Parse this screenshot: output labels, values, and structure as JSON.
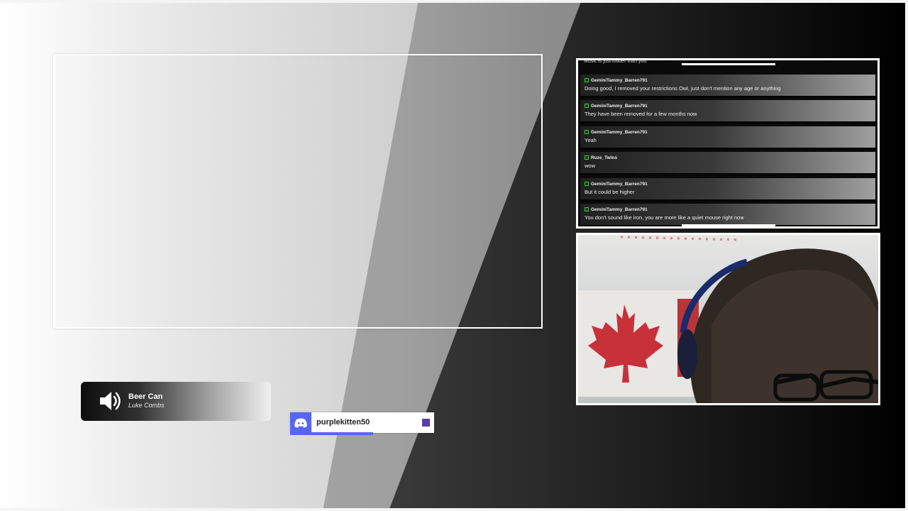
{
  "colors": {
    "frame_border": "#ffffff",
    "discord_blurple": "#5865f2",
    "discord_square": "#5a3ea8",
    "chat_badge": "#3fbf3f"
  },
  "chat": {
    "cutoff_text": "Music is just louder than you",
    "messages": [
      {
        "user": "GeminiTammy_Barren791",
        "text": "Doing good, I removed your restrictions Owl, just don't mention any age or anything"
      },
      {
        "user": "GeminiTammy_Barren791",
        "text": "They have been removed for a few months now"
      },
      {
        "user": "GeminiTammy_Barren791",
        "text": "Yeah"
      },
      {
        "user": "Ruze_Twins",
        "text": "wow"
      },
      {
        "user": "GeminiTammy_Barren791",
        "text": "But it could be higher"
      },
      {
        "user": "GeminiTammy_Barren791",
        "text": "You don't sound like iron, you are more like a quiet mouse right now"
      }
    ]
  },
  "now_playing": {
    "title": "Beer Can",
    "artist": "Luke Combs",
    "icon": "speaker-icon"
  },
  "discord": {
    "username": "purplekitten50",
    "icon": "discord-icon"
  }
}
